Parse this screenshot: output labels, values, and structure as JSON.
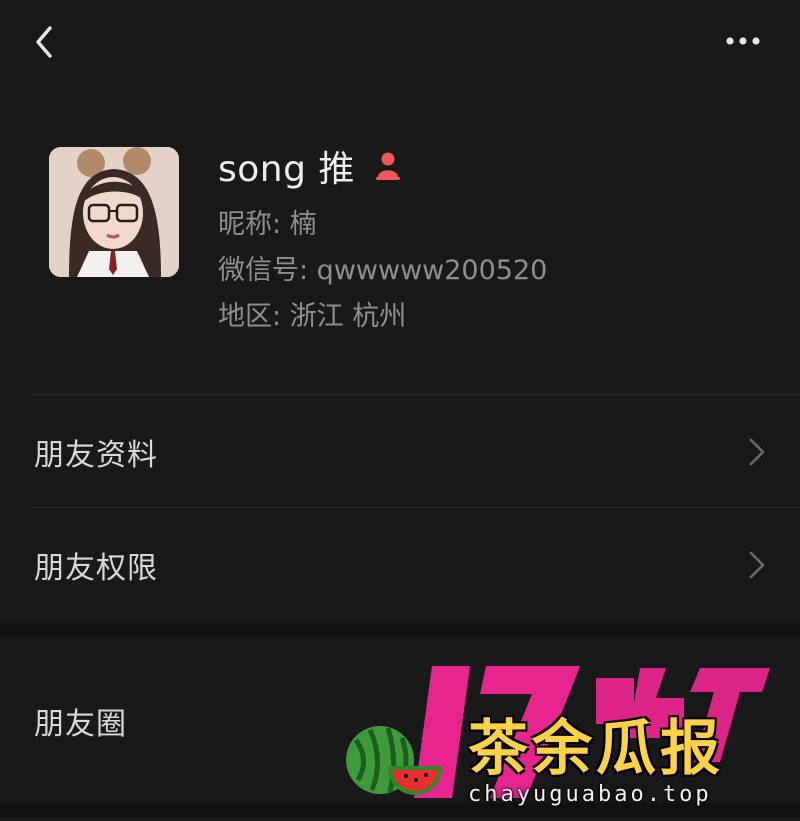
{
  "header": {
    "back_icon": "chevron-left-icon",
    "more_icon": "more-horizontal-icon"
  },
  "profile": {
    "display_name": "song 推",
    "nickname": "昵称: 楠",
    "wechat_id": "微信号: qwwwww200520",
    "region": "地区: 浙江 杭州",
    "gender_icon": "female-gender-icon",
    "gender_color": "#e85a5a"
  },
  "menu": {
    "items": [
      {
        "label": "朋友资料",
        "icon": "chevron-right-icon"
      },
      {
        "label": "朋友权限",
        "icon": "chevron-right-icon"
      },
      {
        "label": "朋友圈"
      }
    ]
  },
  "watermark": {
    "title": "茶余瓜报",
    "site": "chayuguabao.top",
    "brand_color": "#e8258f",
    "title_color": "#ffd24a"
  }
}
